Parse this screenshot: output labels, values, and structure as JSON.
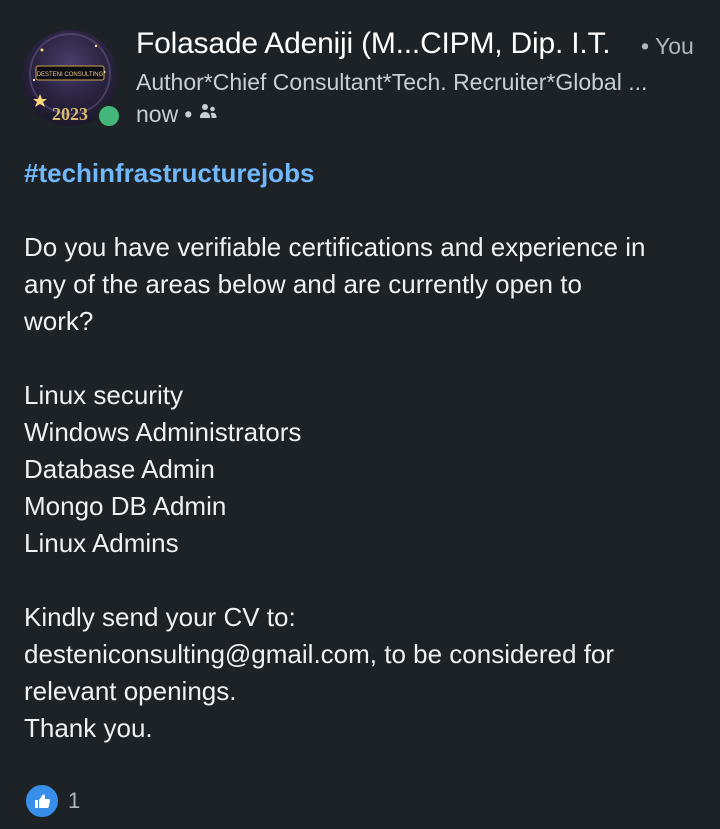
{
  "author": {
    "name": "Folasade Adeniji (M...CIPM, Dip. I.T.",
    "degree": "• You",
    "headline": "Author*Chief Consultant*Tech. Recruiter*Global ...",
    "time": "now",
    "visibility_icon": "connections-icon",
    "avatar_badge_text": "DESTENI CONSULTING",
    "avatar_year": "2023",
    "online": true
  },
  "post": {
    "hashtag": "#techinfrastructurejobs",
    "intro_lines": [
      "Do you have verifiable certifications and experience in",
      "any of the areas below and are currently open to",
      "work?"
    ],
    "roles": [
      "Linux security",
      "Windows Administrators",
      "Database Admin",
      "Mongo DB Admin",
      "Linux Admins"
    ],
    "closing_lines": [
      "Kindly send your CV to:",
      "desteniconsulting@gmail.com, to be considered for",
      "relevant openings.",
      "Thank you."
    ]
  },
  "reactions": {
    "icon": "like-icon",
    "count": "1"
  },
  "colors": {
    "background": "#1d2226",
    "hashtag": "#71b7fb",
    "online": "#43b67a",
    "like": "#378fe9"
  }
}
